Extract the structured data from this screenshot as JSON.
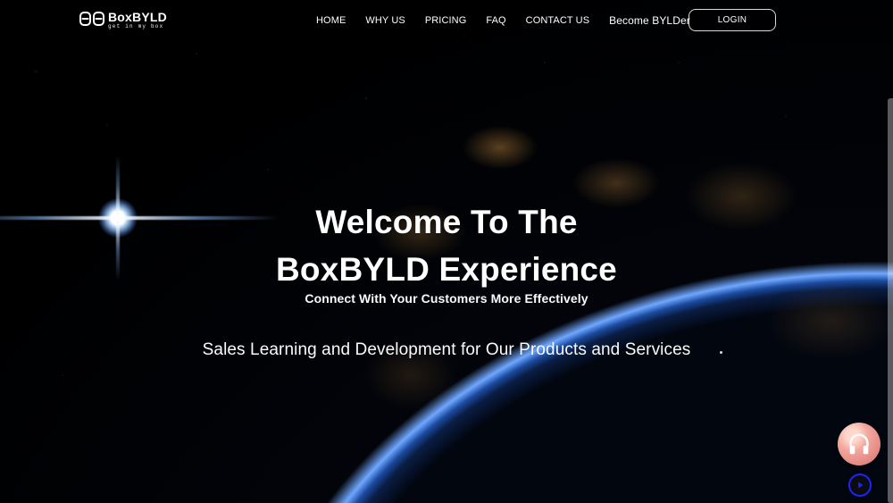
{
  "brand": {
    "name": "BoxBYLD",
    "tagline": "get in my box",
    "icon": "boxbyld-logo-mark"
  },
  "nav": {
    "items": [
      {
        "label": "HOME"
      },
      {
        "label": "WHY US"
      },
      {
        "label": "PRICING"
      },
      {
        "label": "FAQ"
      },
      {
        "label": "CONTACT US"
      },
      {
        "label": "Become BYLDer"
      }
    ],
    "login_label": "LOGIN"
  },
  "hero": {
    "headline_line1": "Welcome To The",
    "headline_line2": "BoxBYLD Experience",
    "subheadline": "Connect With Your Customers More Effectively",
    "tagline": "Sales Learning and Development for Our Products and Services"
  },
  "widgets": {
    "audio_icon": "headphones-icon",
    "play_icon": "play-icon"
  },
  "colors": {
    "text": "#ffffff",
    "background": "#000000",
    "audio_button": "#e58f8f",
    "play_button": "#1b24ff"
  }
}
